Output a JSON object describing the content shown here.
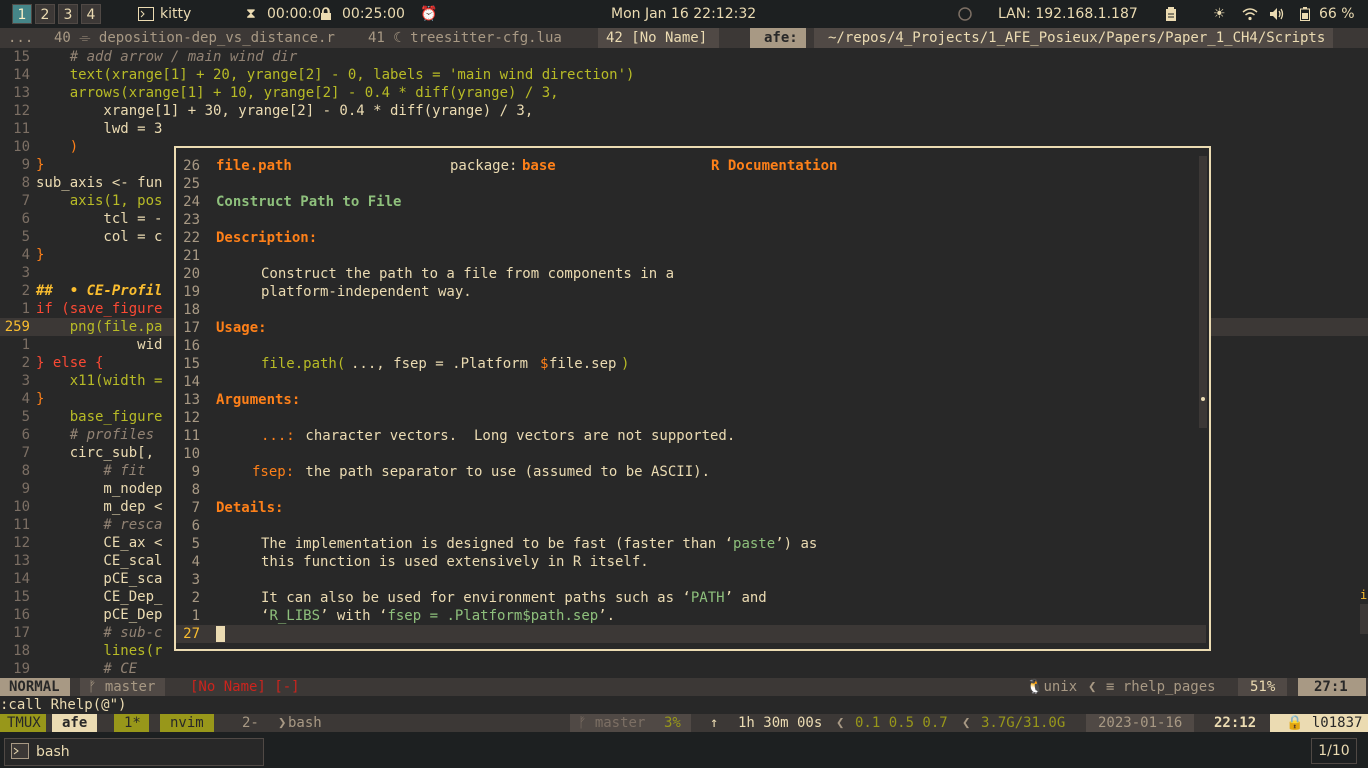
{
  "topbar": {
    "workspaces": [
      "1",
      "2",
      "3",
      "4"
    ],
    "app_name": "kitty",
    "timer1": "00:00:00",
    "timer2": "00:25:00",
    "datetime": "Mon Jan 16  22:12:32",
    "lan": "LAN: 192.168.1.187",
    "battery": "66 %"
  },
  "tabline": {
    "prefix": "...",
    "tab1": "40 ⌯ deposition-dep_vs_distance.r",
    "tab2": "41 ☾ treesitter-cfg.lua",
    "tab3": "42 [No Name]",
    "session": "afe:",
    "path": "~/repos/4_Projects/1_AFE_Posieux/Papers/Paper_1_CH4/Scripts"
  },
  "editor": {
    "line_numbers": [
      "15",
      "14",
      "13",
      "12",
      "11",
      "10",
      "9",
      "8",
      "7",
      "6",
      "5",
      "4",
      "3",
      "2",
      "1",
      "259",
      "1",
      "2",
      "3",
      "4",
      "5",
      "6",
      "7",
      "8",
      "9",
      "10",
      "11",
      "12",
      "13",
      "14",
      "15",
      "16",
      "17",
      "18",
      "19"
    ],
    "lines": [
      "    # add arrow / main wind dir",
      "    text(xrange[1] + 20, yrange[2] - 0, labels = 'main wind direction')",
      "    arrows(xrange[1] + 10, yrange[2] - 0.4 * diff(yrange) / 3,",
      "        xrange[1] + 30, yrange[2] - 0.4 * diff(yrange) / 3,",
      "        lwd = 3",
      "    )",
      "}",
      "sub_axis <- fun",
      "    axis(1, pos",
      "        tcl = -",
      "        col = c",
      "}",
      "",
      "##  • CE-Profil",
      "if (save_figure",
      "    png(file.pa",
      "            wid",
      "} else {",
      "    x11(width =",
      "}",
      "    base_figure",
      "    # profiles",
      "    circ_sub[,",
      "        # fit",
      "        m_nodep",
      "        m_dep <",
      "        # resca",
      "        CE_ax <",
      "        CE_scal",
      "        pCE_sca",
      "        CE_Dep_",
      "        pCE_Dep",
      "        # sub-c",
      "        lines(r",
      "        # CE"
    ]
  },
  "popup": {
    "line_numbers": [
      "26",
      "25",
      "24",
      "23",
      "22",
      "21",
      "20",
      "19",
      "18",
      "17",
      "16",
      "15",
      "14",
      "13",
      "12",
      "11",
      "10",
      "9",
      "8",
      "7",
      "6",
      "5",
      "4",
      "3",
      "2",
      "1",
      "27"
    ],
    "topic": "file.path",
    "package_label": "package:",
    "package_name": "base",
    "doc_label": "R Documentation",
    "title": "Construct Path to File",
    "description_hdr": "Description:",
    "desc1": "Construct the path to a file from components in a",
    "desc2": "platform-independent way.",
    "usage_hdr": "Usage:",
    "usage_fn": "file.path(",
    "usage_args": "..., fsep = .Platform",
    "usage_dollar": "$",
    "usage_end": "file.sep",
    "usage_close": ")",
    "arguments_hdr": "Arguments:",
    "arg1_name": "...:",
    "arg1_desc": " character vectors.  Long vectors are not supported.",
    "arg2_name": "fsep:",
    "arg2_desc": " the path separator to use (assumed to be ASCII).",
    "details_hdr": "Details:",
    "det1a": "The implementation is designed to be fast (faster than ‘",
    "det1b": "paste",
    "det1c": "’) as",
    "det2": "this function is used extensively in R itself.",
    "det3a": "It can also be used for environment paths such as ‘",
    "det3b": "PATH",
    "det3c": "’ and",
    "det4a": "‘",
    "det4b": "R_LIBS",
    "det4c": "’ with ‘",
    "det4d": "fsep = .Platform$path.sep",
    "det4e": "’."
  },
  "statusline": {
    "mode": "NORMAL",
    "branch": "ᚠ master",
    "buffer": "[No Name] [-]",
    "fileformat": "unix",
    "filetype": "≡ rhelp_pages",
    "percent": "51%",
    "position": "27:1"
  },
  "cmdline": ":call Rhelp(@\")",
  "tmux": {
    "label": "TMUX",
    "session": "afe",
    "win1": "1*",
    "win1_name": "nvim",
    "win2": "2-",
    "win2_name": "bash",
    "branch": "ᚠ master",
    "cpu": "3%",
    "uptime": "1h 30m 00s",
    "load": "0.1 0.5 0.7",
    "mem": "3.7G/31.0G",
    "date": "2023-01-16",
    "time": "22:12",
    "host": "🔒 l01837"
  },
  "taskbar": {
    "task": "bash",
    "pager": "1/10"
  }
}
